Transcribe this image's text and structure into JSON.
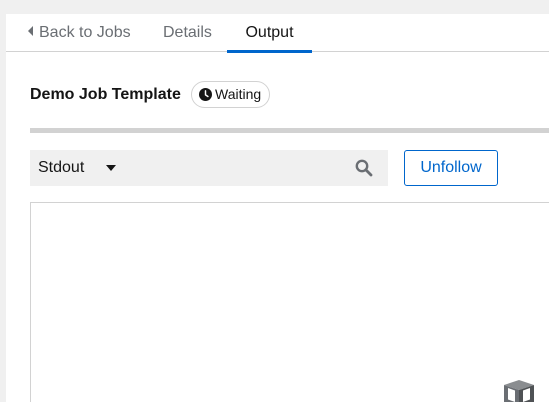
{
  "tabs": {
    "back_label": "Back to Jobs",
    "details_label": "Details",
    "output_label": "Output",
    "active": "Output"
  },
  "job": {
    "title": "Demo Job Template",
    "status": "Waiting"
  },
  "search": {
    "filter_selected": "Stdout",
    "placeholder": ""
  },
  "actions": {
    "unfollow_label": "Unfollow"
  },
  "icons": {
    "back": "caret-left-icon",
    "status": "clock-icon",
    "filter": "caret-down-icon",
    "search": "search-icon",
    "corner": "cube-icon"
  },
  "colors": {
    "accent": "#0066cc",
    "border": "#d2d2d2",
    "muted_text": "#6a6e73",
    "page_bg": "#f0f0f0"
  }
}
